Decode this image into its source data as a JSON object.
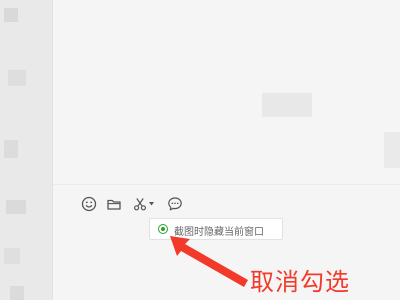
{
  "toolbar": {
    "icons": [
      "emoji-icon",
      "folder-icon",
      "scissors-icon",
      "chat-bubble-icon"
    ]
  },
  "screenshot_popup": {
    "label": "截图时隐藏当前窗口",
    "checked": true
  },
  "annotation": {
    "text": "取消勾选",
    "color": "#f23a2a"
  },
  "colors": {
    "accent_green": "#2aa32c",
    "icon_gray": "#555555"
  }
}
